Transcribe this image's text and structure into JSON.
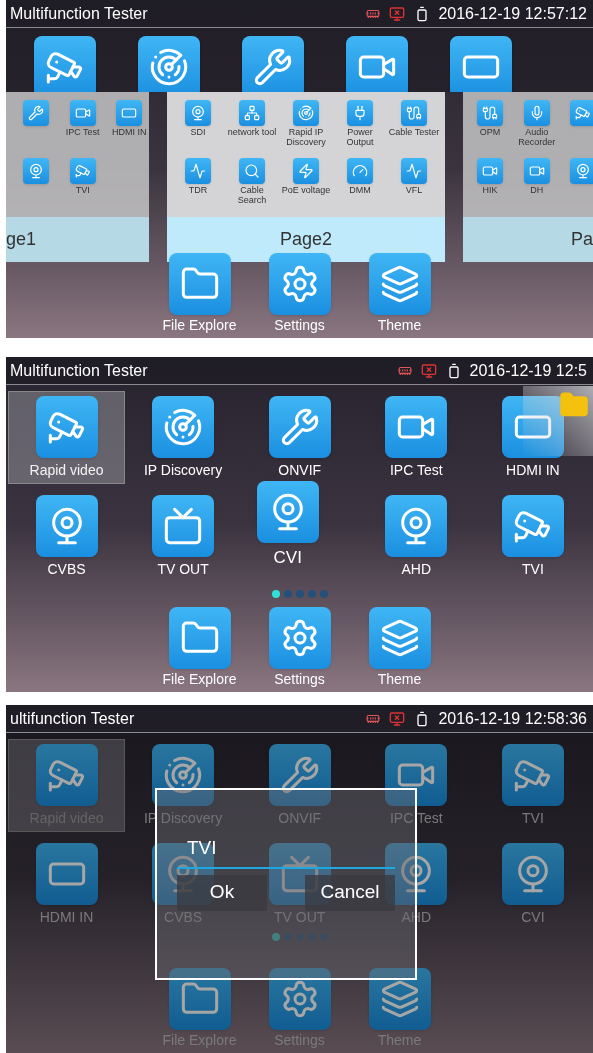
{
  "screens": [
    {
      "kind": "overview",
      "status": {
        "title": "Multifunction Tester",
        "time": "2016-12-19 12:57:12"
      },
      "pages": [
        {
          "label": "ge1",
          "selected": false,
          "items": [
            {
              "kind": "cut"
            },
            {
              "kind": "app",
              "label": "IPC Test"
            },
            {
              "kind": "app",
              "label": "HDMI IN"
            },
            {
              "kind": "cut"
            },
            {
              "kind": "app",
              "label": "TVI"
            }
          ]
        },
        {
          "label": "Page2",
          "selected": true,
          "items": [
            {
              "kind": "app",
              "label": "SDI"
            },
            {
              "kind": "app",
              "label": "network tool"
            },
            {
              "kind": "app",
              "label": "Rapid IP Discovery"
            },
            {
              "kind": "app",
              "label": "Power Output"
            },
            {
              "kind": "app",
              "label": "Cable Tester"
            },
            {
              "kind": "app",
              "label": "TDR"
            },
            {
              "kind": "app",
              "label": "Cable Search"
            },
            {
              "kind": "app",
              "label": "PoE voltage"
            },
            {
              "kind": "app",
              "label": "DMM"
            },
            {
              "kind": "app",
              "label": "VFL"
            }
          ]
        },
        {
          "label": "Pa",
          "selected": false,
          "items": [
            {
              "kind": "app",
              "label": "OPM"
            },
            {
              "kind": "app",
              "label": "Audio Recorder"
            },
            {
              "kind": "cut"
            },
            {
              "kind": "app",
              "label": "HIK"
            },
            {
              "kind": "app",
              "label": "DH"
            },
            {
              "kind": "cut"
            }
          ]
        }
      ],
      "dock": [
        "File Explore",
        "Settings",
        "Theme"
      ]
    },
    {
      "kind": "home",
      "status": {
        "title": "Multifunction Tester",
        "time": "2016-12-19 12:5"
      },
      "add_folder": true,
      "apps": [
        {
          "label": "Rapid video",
          "selected": true,
          "dragging": false
        },
        {
          "label": "IP Discovery",
          "selected": false,
          "dragging": false
        },
        {
          "label": "ONVIF",
          "selected": false,
          "dragging": false
        },
        {
          "label": "IPC Test",
          "selected": false,
          "dragging": false
        },
        {
          "label": "HDMI IN",
          "selected": false,
          "dragging": false
        },
        {
          "label": "CVBS",
          "selected": false,
          "dragging": false
        },
        {
          "label": "TV OUT",
          "selected": false,
          "dragging": false
        },
        {
          "label": "CVI",
          "selected": false,
          "dragging": true
        },
        {
          "label": "AHD",
          "selected": false,
          "dragging": false
        },
        {
          "label": "TVI",
          "selected": false,
          "dragging": false
        }
      ],
      "dots": [
        {
          "selected": true
        },
        {
          "selected": false
        },
        {
          "selected": false
        },
        {
          "selected": false
        },
        {
          "selected": false
        }
      ],
      "dock": [
        "File Explore",
        "Settings",
        "Theme"
      ]
    },
    {
      "kind": "dialog",
      "status": {
        "title": "ultifunction Tester",
        "time": "2016-12-19 12:58:36"
      },
      "add_folder": false,
      "apps": [
        {
          "label": "Rapid video",
          "selected": true,
          "dragging": false
        },
        {
          "label": "IP Discovery",
          "selected": false,
          "dragging": false
        },
        {
          "label": "ONVIF",
          "selected": false,
          "dragging": false
        },
        {
          "label": "IPC Test",
          "selected": false,
          "dragging": false
        },
        {
          "label": "TVI",
          "selected": false,
          "dragging": false
        },
        {
          "label": "HDMI IN",
          "selected": false,
          "dragging": false
        },
        {
          "label": "CVBS",
          "selected": false,
          "dragging": false
        },
        {
          "label": "TV OUT",
          "selected": false,
          "dragging": false
        },
        {
          "label": "AHD",
          "selected": false,
          "dragging": false
        },
        {
          "label": "CVI",
          "selected": false,
          "dragging": false
        }
      ],
      "dots": [
        {
          "selected": true
        },
        {
          "selected": false
        },
        {
          "selected": false
        },
        {
          "selected": false
        },
        {
          "selected": false
        }
      ],
      "dock": [
        "File Explore",
        "Settings",
        "Theme"
      ],
      "dialog": {
        "value": "TVI",
        "buttons": [
          "Ok",
          "Cancel"
        ]
      }
    }
  ]
}
